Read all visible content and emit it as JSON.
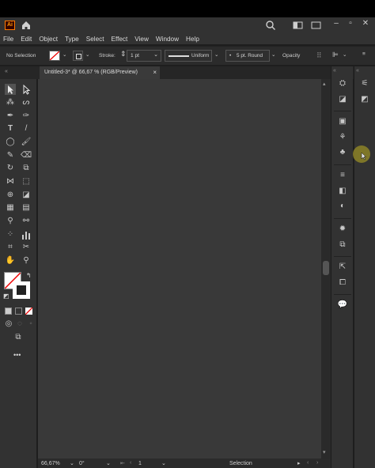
{
  "app": {
    "logo": "Ai"
  },
  "menu": [
    "File",
    "Edit",
    "Object",
    "Type",
    "Select",
    "Effect",
    "View",
    "Window",
    "Help"
  ],
  "control": {
    "selection": "No Selection",
    "stroke_label": "Stroke:",
    "stroke_weight": "1 pt",
    "profile": "Uniform",
    "brush": "5 pt. Round",
    "opacity": "Opacity"
  },
  "tab": {
    "title": "Untitled-3* @ 66,67 % (RGB/Preview)",
    "close": "×"
  },
  "status": {
    "zoom": "66,67%",
    "rotation": "0°",
    "artboard": "1",
    "tool": "Selection"
  },
  "toolbar": {
    "more": "•••"
  },
  "colors": {
    "accent": "#ff7c00",
    "canvas": "#393939",
    "chrome": "#323232"
  }
}
